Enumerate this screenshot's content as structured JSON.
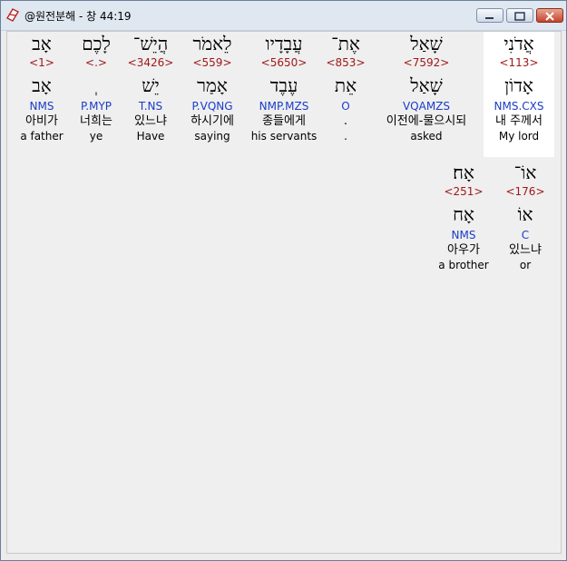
{
  "window": {
    "title": "@원전분해 - 창 44:19"
  },
  "words": [
    {
      "hebrew": "אֲדֹנִי",
      "strong": "<113>",
      "lemma": "אָדוֹן",
      "parse": "NMS.CXS",
      "korean": "내 주께서",
      "english": "My lord"
    },
    {
      "hebrew": "שָׁאַל",
      "strong": "<7592>",
      "lemma": "שָׁאַל",
      "parse": "VQAMZS",
      "korean": "이전에-물으시되",
      "english": "asked"
    },
    {
      "hebrew": "אֶת־",
      "strong": "<853>",
      "lemma": "אֵת",
      "parse": "O",
      "korean": ".",
      "english": "."
    },
    {
      "hebrew": "עֲבָדָיו",
      "strong": "<5650>",
      "lemma": "עֶבֶד",
      "parse": "NMP.MZS",
      "korean": "종들에게",
      "english": "his servants"
    },
    {
      "hebrew": "לֵאמֹר",
      "strong": "<559>",
      "lemma": "אָמַר",
      "parse": "P.VQNG",
      "korean": "하시기에",
      "english": "saying"
    },
    {
      "hebrew": "הֲיֵשׁ־",
      "strong": "<3426>",
      "lemma": "יֵשׁ",
      "parse": "T.NS",
      "korean": "있느냐",
      "english": "Have"
    },
    {
      "hebrew": "לָכֶם",
      "strong": "<.>",
      "lemma": "ְ",
      "parse": "P.MYP",
      "korean": "너희는",
      "english": "ye"
    },
    {
      "hebrew": "אָב",
      "strong": "<1>",
      "lemma": "אָב",
      "parse": "NMS",
      "korean": "아비가",
      "english": "a father"
    },
    {
      "hebrew": "אוֹ־",
      "strong": "<176>",
      "lemma": "אוֹ",
      "parse": "C",
      "korean": "있느냐",
      "english": "or"
    },
    {
      "hebrew": "אָח׃",
      "strong": "<251>",
      "lemma": "אָח",
      "parse": "NMS",
      "korean": "아우가",
      "english": "a brother"
    }
  ]
}
